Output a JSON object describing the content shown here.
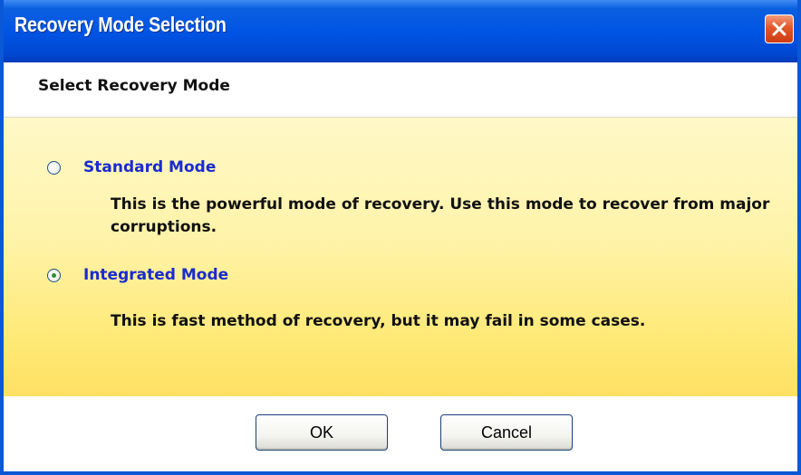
{
  "window": {
    "title": "Recovery Mode Selection"
  },
  "header": {
    "title": "Select Recovery Mode"
  },
  "options": [
    {
      "label": "Standard Mode",
      "description": "This is the powerful mode of recovery. Use this mode to recover from major corruptions.",
      "selected": false
    },
    {
      "label": "Integrated Mode",
      "description": "This is fast method of recovery, but it may fail in some cases.",
      "selected": true
    }
  ],
  "buttons": {
    "ok_label": "OK",
    "cancel_label": "Cancel"
  },
  "icons": {
    "close": "close-icon",
    "radio": "radio-button-icon"
  },
  "colors": {
    "titlebar": "#0055e5",
    "close_button": "#e2582b",
    "option_label": "#1a2bd0",
    "content_background": "#fff3a8",
    "radio_dot": "#2f8f2f"
  }
}
